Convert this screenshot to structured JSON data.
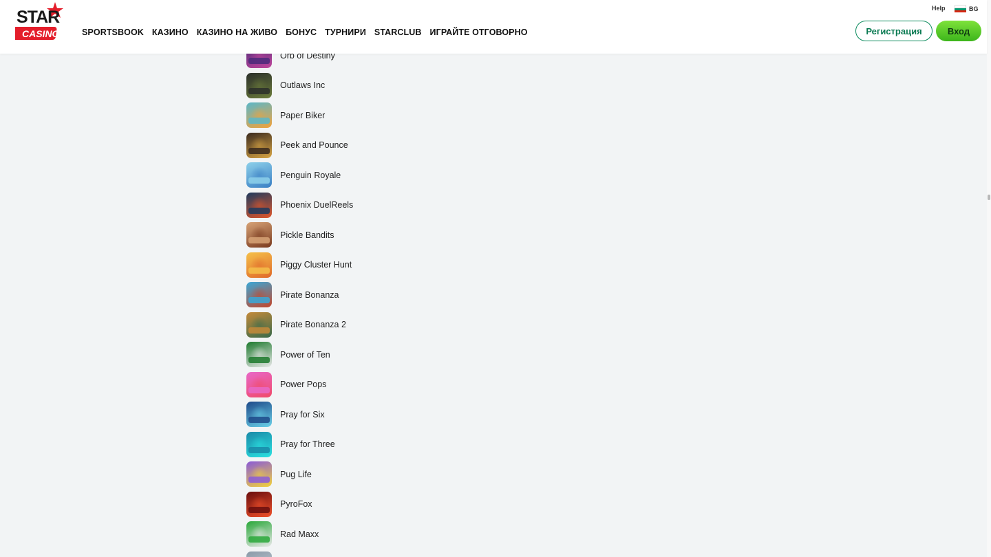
{
  "brand": {
    "logo_top": "STAR",
    "logo_bottom": "CASINO",
    "red": "#e41e2b",
    "accent_green": "#0a8a5c"
  },
  "nav": [
    "SPORTSBOOK",
    "КАЗИНО",
    "КАЗИНО НА ЖИВО",
    "БОНУС",
    "ТУРНИРИ",
    "STARCLUB",
    "ИГРАЙТЕ ОТГОВОРНО"
  ],
  "topbar": {
    "help": "Help",
    "lang": "BG"
  },
  "auth": {
    "register": "Регистрация",
    "login": "Вход"
  },
  "games": [
    {
      "name": "Orb of Destiny",
      "colors": [
        "#4b2a7a",
        "#c0469b"
      ]
    },
    {
      "name": "Outlaws Inc",
      "colors": [
        "#2b2f2a",
        "#6a7a3a"
      ]
    },
    {
      "name": "Paper Biker",
      "colors": [
        "#5ab7c9",
        "#f2a23a"
      ]
    },
    {
      "name": "Peek and Pounce",
      "colors": [
        "#3a2a1e",
        "#d8a544"
      ]
    },
    {
      "name": "Penguin Royale",
      "colors": [
        "#8dd0ea",
        "#3a7fc4"
      ]
    },
    {
      "name": "Phoenix DuelReels",
      "colors": [
        "#1e3a5e",
        "#e0562a"
      ]
    },
    {
      "name": "Pickle Bandits",
      "colors": [
        "#d7a377",
        "#7a3a1e"
      ]
    },
    {
      "name": "Piggy Cluster Hunt",
      "colors": [
        "#f5c04a",
        "#e06a2a"
      ]
    },
    {
      "name": "Pirate Bonanza",
      "colors": [
        "#3aa8d8",
        "#c4462a"
      ]
    },
    {
      "name": "Pirate Bonanza 2",
      "colors": [
        "#c48a3a",
        "#3a6a4a"
      ]
    },
    {
      "name": "Power of Ten",
      "colors": [
        "#1e7a2e",
        "#e8e8e8"
      ]
    },
    {
      "name": "Power Pops",
      "colors": [
        "#e868c8",
        "#f04a6a"
      ]
    },
    {
      "name": "Pray for Six",
      "colors": [
        "#1e4a8a",
        "#6ad0e8"
      ]
    },
    {
      "name": "Pray for Three",
      "colors": [
        "#1a8aa8",
        "#2ae0e0"
      ]
    },
    {
      "name": "Pug Life",
      "colors": [
        "#8a5ad8",
        "#f2d23a"
      ]
    },
    {
      "name": "PyroFox",
      "colors": [
        "#6a0e0e",
        "#f0502a"
      ]
    },
    {
      "name": "Rad Maxx",
      "colors": [
        "#2aa83a",
        "#e8e8e8"
      ]
    },
    {
      "name": "",
      "colors": [
        "#8a9aa8",
        "#c8d0d8"
      ]
    }
  ]
}
